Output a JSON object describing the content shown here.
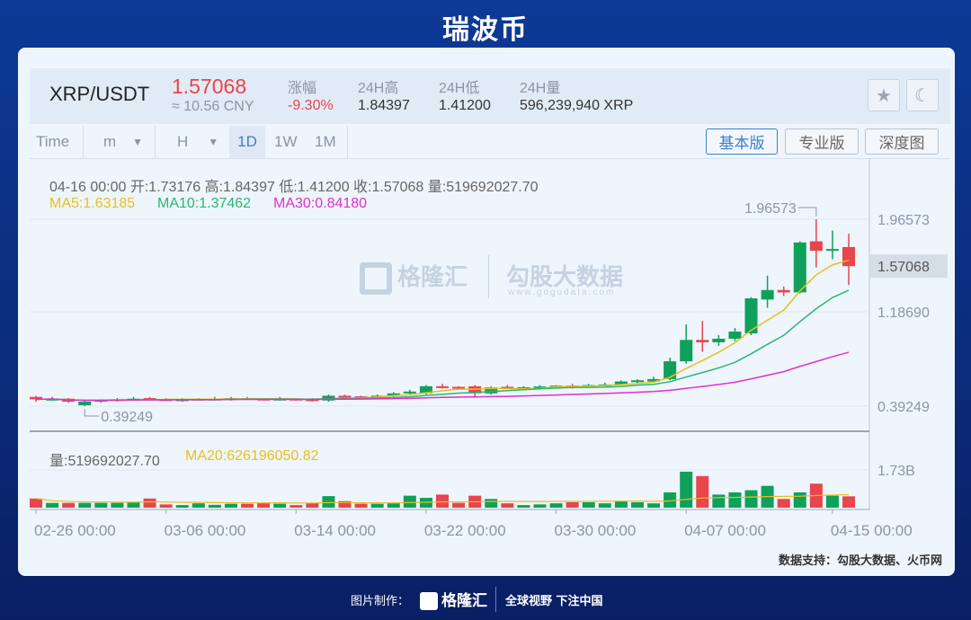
{
  "page_title": "瑞波币",
  "ticker": {
    "pair": "XRP/USDT",
    "price": "1.57068",
    "cny": "≈ 10.56 CNY",
    "stats": [
      {
        "label": "涨幅",
        "value": "-9.30%"
      },
      {
        "label": "24H高",
        "value": "1.84397"
      },
      {
        "label": "24H低",
        "value": "1.41200"
      },
      {
        "label": "24H量",
        "value": "596,239,940 XRP"
      }
    ]
  },
  "toolbar": {
    "time": "Time",
    "minute": "m",
    "hour": "H",
    "periods": [
      "1D",
      "1W",
      "1M"
    ],
    "selected": "1D",
    "views": [
      "基本版",
      "专业版",
      "深度图"
    ],
    "selected_view": "基本版"
  },
  "icons": {
    "favorite": "star-icon",
    "theme": "moon-icon"
  },
  "info_line": "04-16 00:00  开:1.73176  高:1.84397  低:1.41200  收:1.57068  量:519692027.70",
  "ma": {
    "ma5": "MA5:1.63185",
    "ma10": "MA10:1.37462",
    "ma30": "MA30:0.84180"
  },
  "vol_info": {
    "vol": "量:519692027.70",
    "ma20": "MA20:626196050.82"
  },
  "colors": {
    "up": "#0fa05a",
    "down": "#e8454d",
    "ma5": "#e8c020",
    "ma10": "#2bb673",
    "ma30": "#e030d0",
    "accent": "#3a7fd5"
  },
  "watermark": {
    "brand1": "格隆汇",
    "brand1_url": "www.gelonghui.com",
    "brand2": "勾股大数据",
    "brand2_url": "www.gogudata.com"
  },
  "chart_data": {
    "type": "candlestick",
    "x_ticks": [
      "02-26 00:00",
      "03-06 00:00",
      "03-14 00:00",
      "03-22 00:00",
      "03-30 00:00",
      "04-07 00:00",
      "04-15 00:00"
    ],
    "x_tick_index": [
      0,
      8,
      16,
      24,
      32,
      40,
      49
    ],
    "y_ticks": [
      "1.96573",
      "1.18690",
      "0.39249"
    ],
    "y_tick_values": [
      1.96573,
      1.1869,
      0.39249
    ],
    "current_price_label": "1.57068",
    "current_price": 1.57068,
    "max_label": "1.96573",
    "min_label": "0.39249",
    "ylim": [
      0.39249,
      1.96573
    ],
    "vol_tick": "1.73B",
    "vol_tick_value": 1.73,
    "candles_ohlc": [
      [
        0.47,
        0.48,
        0.43,
        0.45
      ],
      [
        0.45,
        0.47,
        0.44,
        0.455
      ],
      [
        0.455,
        0.46,
        0.42,
        0.43
      ],
      [
        0.4,
        0.44,
        0.39249,
        0.43
      ],
      [
        0.43,
        0.45,
        0.42,
        0.445
      ],
      [
        0.44,
        0.46,
        0.43,
        0.45
      ],
      [
        0.445,
        0.47,
        0.44,
        0.455
      ],
      [
        0.46,
        0.47,
        0.44,
        0.45
      ],
      [
        0.45,
        0.46,
        0.44,
        0.445
      ],
      [
        0.445,
        0.46,
        0.43,
        0.45
      ],
      [
        0.445,
        0.46,
        0.44,
        0.455
      ],
      [
        0.45,
        0.47,
        0.44,
        0.455
      ],
      [
        0.455,
        0.47,
        0.44,
        0.46
      ],
      [
        0.46,
        0.47,
        0.45,
        0.455
      ],
      [
        0.455,
        0.46,
        0.44,
        0.45
      ],
      [
        0.45,
        0.47,
        0.44,
        0.455
      ],
      [
        0.455,
        0.46,
        0.44,
        0.445
      ],
      [
        0.45,
        0.46,
        0.43,
        0.44
      ],
      [
        0.44,
        0.49,
        0.43,
        0.48
      ],
      [
        0.48,
        0.49,
        0.47,
        0.475
      ],
      [
        0.475,
        0.48,
        0.46,
        0.47
      ],
      [
        0.47,
        0.49,
        0.46,
        0.48
      ],
      [
        0.48,
        0.51,
        0.47,
        0.5
      ],
      [
        0.5,
        0.53,
        0.49,
        0.515
      ],
      [
        0.5,
        0.57,
        0.49,
        0.56
      ],
      [
        0.56,
        0.58,
        0.54,
        0.555
      ],
      [
        0.555,
        0.56,
        0.53,
        0.545
      ],
      [
        0.56,
        0.57,
        0.47,
        0.5
      ],
      [
        0.5,
        0.56,
        0.49,
        0.55
      ],
      [
        0.555,
        0.57,
        0.54,
        0.55
      ],
      [
        0.55,
        0.56,
        0.54,
        0.552
      ],
      [
        0.55,
        0.57,
        0.54,
        0.558
      ],
      [
        0.555,
        0.57,
        0.54,
        0.565
      ],
      [
        0.565,
        0.58,
        0.54,
        0.56
      ],
      [
        0.56,
        0.58,
        0.55,
        0.57
      ],
      [
        0.57,
        0.59,
        0.56,
        0.575
      ],
      [
        0.575,
        0.61,
        0.57,
        0.6
      ],
      [
        0.6,
        0.62,
        0.58,
        0.61
      ],
      [
        0.6,
        0.64,
        0.59,
        0.62
      ],
      [
        0.62,
        0.8,
        0.61,
        0.77
      ],
      [
        0.77,
        1.08,
        0.75,
        0.95
      ],
      [
        0.95,
        1.11,
        0.85,
        0.93
      ],
      [
        0.93,
        0.99,
        0.9,
        0.96
      ],
      [
        0.96,
        1.05,
        0.94,
        1.02
      ],
      [
        1.005,
        1.31,
        0.99,
        1.3
      ],
      [
        1.29,
        1.49,
        1.22,
        1.37
      ],
      [
        1.37,
        1.4,
        1.32,
        1.35
      ],
      [
        1.35,
        1.78,
        1.34,
        1.77
      ],
      [
        1.78,
        1.96573,
        1.56,
        1.7
      ],
      [
        1.7,
        1.87,
        1.63,
        1.715
      ],
      [
        1.73176,
        1.84397,
        1.412,
        1.57068
      ]
    ],
    "volumes_b": [
      0.42,
      0.22,
      0.22,
      0.22,
      0.22,
      0.22,
      0.25,
      0.42,
      0.15,
      0.12,
      0.2,
      0.13,
      0.18,
      0.18,
      0.2,
      0.18,
      0.12,
      0.2,
      0.53,
      0.3,
      0.18,
      0.18,
      0.2,
      0.55,
      0.45,
      0.6,
      0.22,
      0.55,
      0.4,
      0.2,
      0.12,
      0.15,
      0.2,
      0.25,
      0.25,
      0.2,
      0.3,
      0.25,
      0.2,
      0.7,
      1.65,
      1.45,
      0.6,
      0.7,
      0.8,
      1.0,
      0.4,
      0.7,
      1.1,
      0.55,
      0.52
    ]
  },
  "source": "数据支持：勾股大数据、火币网",
  "footer": {
    "made_by": "图片制作：",
    "brand": "格隆汇",
    "slogan": "全球视野 下注中国"
  }
}
